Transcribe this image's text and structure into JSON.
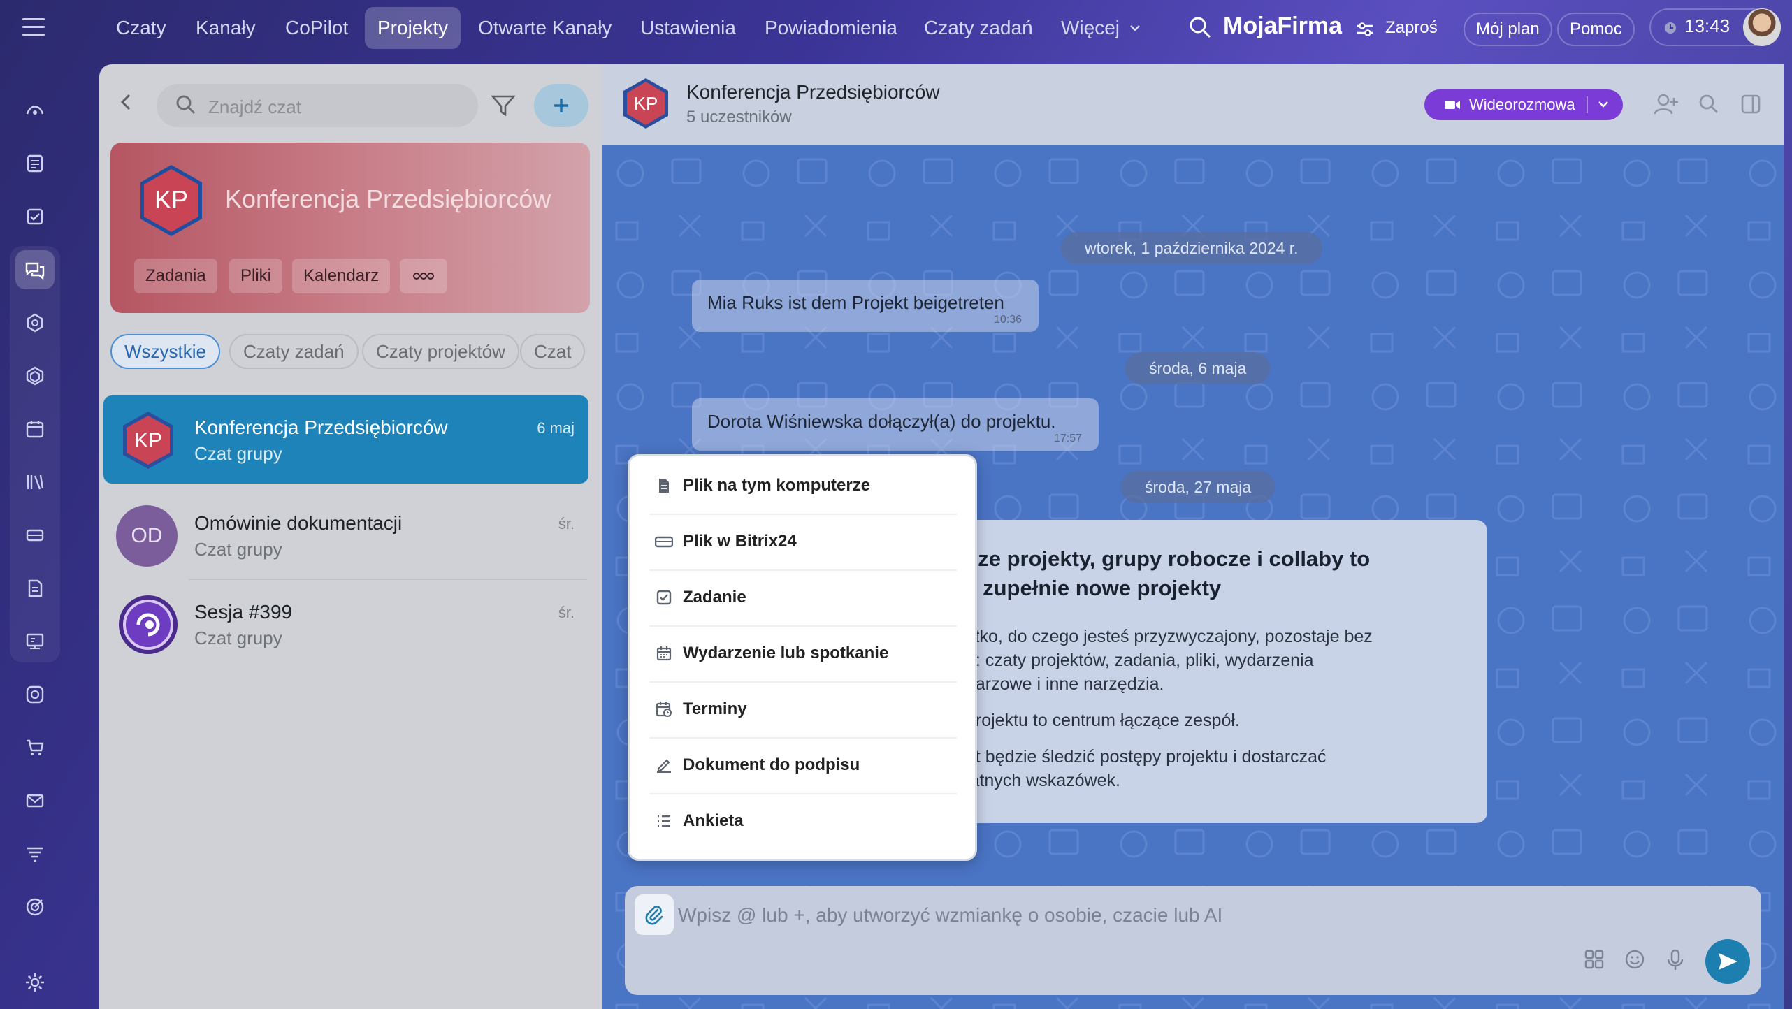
{
  "topnav": {
    "items": [
      {
        "label": "Czaty"
      },
      {
        "label": "Kanały"
      },
      {
        "label": "CoPilot"
      },
      {
        "label": "Projekty"
      },
      {
        "label": "Otwarte Kanały"
      },
      {
        "label": "Ustawienia"
      },
      {
        "label": "Powiadomienia"
      },
      {
        "label": "Czaty zadań"
      },
      {
        "label": "Więcej"
      }
    ],
    "active": "Projekty",
    "brand": "MojaFirma",
    "invite": "Zaproś",
    "plan": "Mój plan",
    "help": "Pomoc",
    "time": "13:43"
  },
  "listpanel": {
    "search_placeholder": "Znajdź czat",
    "project": {
      "initials": "KP",
      "title": "Konferencja Przedsiębiorców",
      "chips": [
        "Zadania",
        "Pliki",
        "Kalendarz"
      ]
    },
    "tabs": [
      "Wszystkie",
      "Czaty zadań",
      "Czaty projektów",
      "Czat"
    ],
    "chats": [
      {
        "initials": "KP",
        "name": "Konferencja Przedsiębiorców",
        "sub": "Czat grupy",
        "date": "6 maj"
      },
      {
        "initials": "OD",
        "name": "Omówinie dokumentacji",
        "sub": "Czat grupy",
        "date": "śr."
      },
      {
        "initials": "",
        "name": "Sesja #399",
        "sub": "Czat grupy",
        "date": "śr."
      }
    ]
  },
  "chat": {
    "header": {
      "initials": "KP",
      "title": "Konferencja Przedsiębiorców",
      "participants": "5 uczestników",
      "video_label": "Wideorozmowa"
    },
    "messages": {
      "date1": "wtorek, 1 października 2024 r.",
      "msg1": "Mia Ruks ist dem Projekt beigetreten",
      "time1": "10:36",
      "date2": "środa, 6 maja",
      "msg2": "Dorota Wiśniewska dołączył(a) do projektu.",
      "time2": "17:57",
      "date3": "środa, 27 maja"
    },
    "card": {
      "title_line1": "sze projekty, grupy robocze i collaby to",
      "title_line2": "z zupełnie nowe projekty",
      "p1_line1": "stko, do czego jesteś przyzwyczajony, pozostaje bez",
      "p1_line2": "n: czaty projektów, zadania, pliki, wydarzenia",
      "p1_line3": "darzowe i inne narzędzia.",
      "p2": "projektu to centrum łączące zespół.",
      "p3_line1": "ot będzie śledzić postępy projektu i dostarczać",
      "p3_line2": "latnych wskazówek."
    },
    "input_placeholder": "Wpisz @ lub +, aby utworzyć wzmiankę o osobie, czacie lub AI"
  },
  "attach_menu": {
    "items": [
      {
        "label": "Plik na tym komputerze",
        "icon": "file-icon"
      },
      {
        "label": "Plik w Bitrix24",
        "icon": "drive-icon"
      },
      {
        "label": "Zadanie",
        "icon": "task-icon"
      },
      {
        "label": "Wydarzenie lub spotkanie",
        "icon": "calendar-icon"
      },
      {
        "label": "Terminy",
        "icon": "schedule-icon"
      },
      {
        "label": "Dokument do podpisu",
        "icon": "sign-icon"
      },
      {
        "label": "Ankieta",
        "icon": "poll-icon"
      }
    ]
  },
  "colors": {
    "accent": "#7b3bd6",
    "active_chat": "#1e83b9",
    "chat_bg": "#4a74c4",
    "project_card": "#b55662"
  }
}
